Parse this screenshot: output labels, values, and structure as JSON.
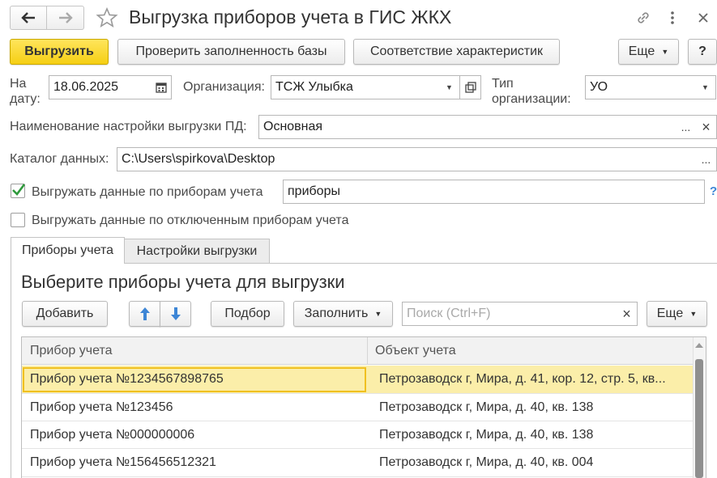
{
  "window": {
    "title": "Выгрузка приборов учета в ГИС ЖКХ"
  },
  "toolbar": {
    "export_label": "Выгрузить",
    "check_label": "Проверить заполненность базы",
    "mapping_label": "Соответствие характеристик",
    "more_label": "Еще",
    "help_label": "?"
  },
  "form": {
    "date_label": "На\nдату:",
    "date_value": "18.06.2025",
    "org_label": "Организация:",
    "org_value": "ТСЖ Улыбка",
    "org_type_label": "Тип\nорганизации:",
    "org_type_value": "УО",
    "setting_label": "Наименование настройки выгрузки ПД:",
    "setting_value": "Основная",
    "catalog_label": "Каталог данных:",
    "catalog_value": "C:\\Users\\spirkova\\Desktop",
    "export_meters_label": "Выгружать данные по приборам учета",
    "export_meters_checked": true,
    "export_meters_value": "приборы",
    "export_disabled_label": "Выгружать данные по отключенным приборам учета",
    "export_disabled_checked": false,
    "help_mark": "?",
    "ellipsis": "...",
    "clear": "×"
  },
  "tabs": [
    {
      "label": "Приборы учета",
      "active": true
    },
    {
      "label": "Настройки выгрузки",
      "active": false
    }
  ],
  "panel": {
    "heading": "Выберите приборы учета для выгрузки",
    "add_label": "Добавить",
    "pick_label": "Подбор",
    "fill_label": "Заполнить",
    "search_placeholder": "Поиск (Ctrl+F)",
    "more_label": "Еще"
  },
  "grid": {
    "columns": [
      "Прибор учета",
      "Объект учета"
    ],
    "rows": [
      {
        "device": "Прибор учета №1234567898765",
        "object": "Петрозаводск г, Мира, д. 41, кор. 12, стр. 5, кв...",
        "selected": true
      },
      {
        "device": "Прибор учета №123456",
        "object": "Петрозаводск г, Мира, д. 40, кв. 138",
        "selected": false
      },
      {
        "device": "Прибор учета №000000006",
        "object": "Петрозаводск г, Мира, д. 40, кв. 138",
        "selected": false
      },
      {
        "device": "Прибор учета №156456512321",
        "object": "Петрозаводск г, Мира, д. 40, кв. 004",
        "selected": false
      }
    ]
  },
  "colors": {
    "primary_button": "#f5cf14",
    "selected_row": "#fbeea9",
    "selected_cell_border": "#f0c020",
    "checkbox_check": "#2f9a3c",
    "up_down_arrows": "#3d86d6"
  }
}
